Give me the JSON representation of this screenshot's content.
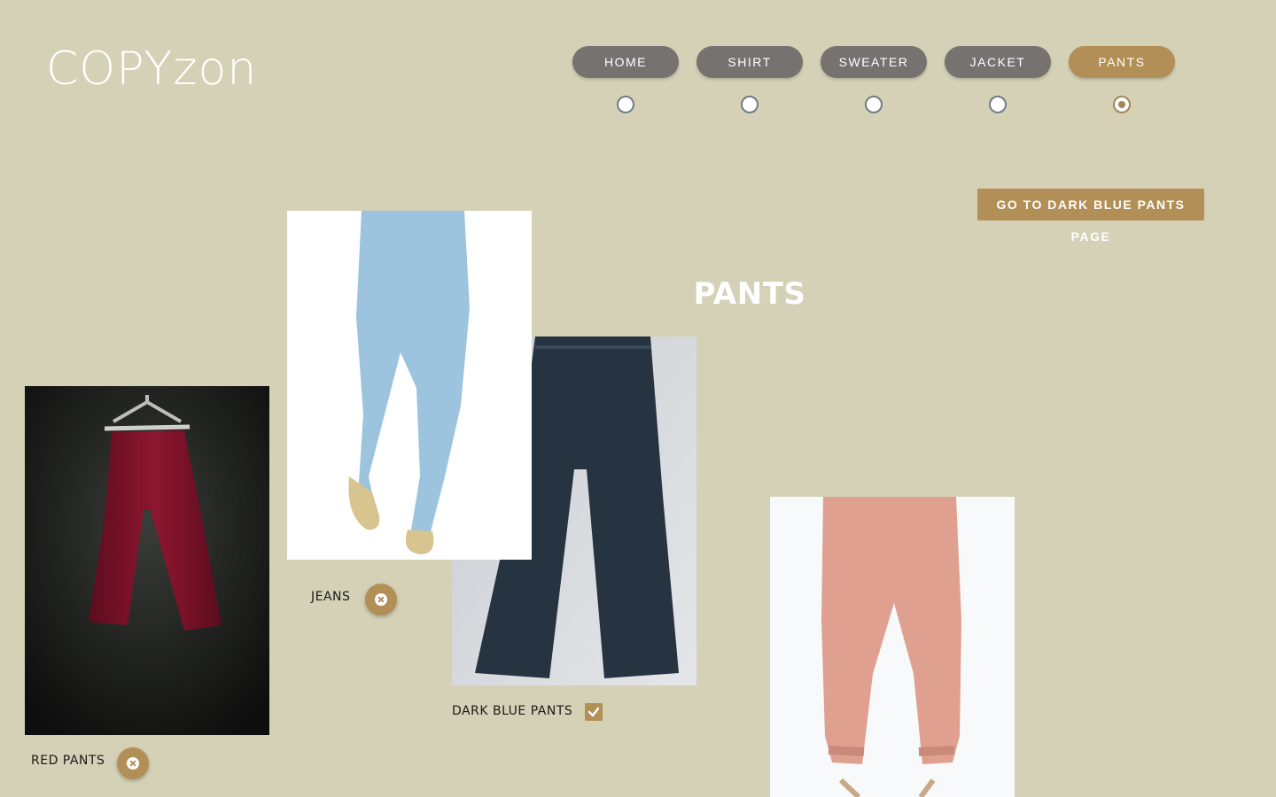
{
  "brand": {
    "logo_text": "COPYzon"
  },
  "nav": {
    "items": [
      {
        "label": "HOME",
        "active": false
      },
      {
        "label": "SHIRT",
        "active": false
      },
      {
        "label": "SWEATER",
        "active": false
      },
      {
        "label": "JACKET",
        "active": false
      },
      {
        "label": "PANTS",
        "active": true
      }
    ]
  },
  "main": {
    "goto_button_label": "GO TO DARK BLUE PANTS PAGE",
    "title": "PANTS"
  },
  "products": [
    {
      "name": "RED PANTS",
      "image": "red-pants-image",
      "control": "remove",
      "icon": "close-icon"
    },
    {
      "name": "JEANS",
      "image": "jeans-image",
      "control": "remove",
      "icon": "close-icon"
    },
    {
      "name": "DARK BLUE PANTS",
      "image": "dark-blue-pants-image",
      "control": "selected",
      "icon": "check-icon"
    },
    {
      "name": "",
      "image": "pink-pants-image",
      "control": "none",
      "icon": ""
    }
  ],
  "colors": {
    "background": "#d4d1b6",
    "nav_inactive": "#767270",
    "accent": "#b28f56",
    "text_light": "#ffffff",
    "text_dark": "#1a1a1a"
  }
}
